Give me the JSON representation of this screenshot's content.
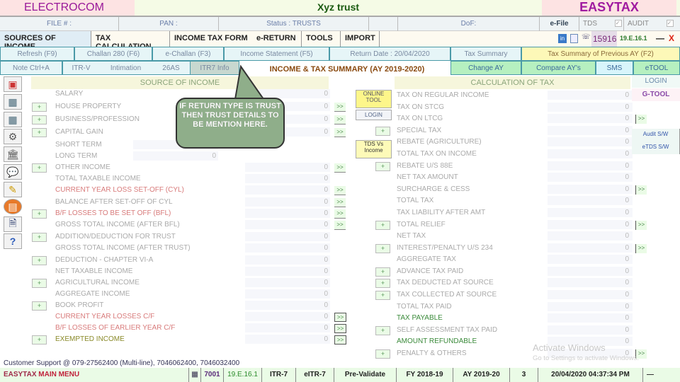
{
  "window": {
    "brand_left": "ELECTROCOM",
    "title": "Xyz trust",
    "brand_right": "EASYTAX"
  },
  "info_bar": {
    "file": "FILE # :",
    "pan": "PAN :",
    "status": "Status : TRUSTS",
    "dof": "DoF:",
    "efile": "e-File",
    "tds": "TDS",
    "audit": "AUDIT",
    "check": "✓"
  },
  "menu": {
    "items": [
      "SOURCES OF INCOME",
      "TAX CALCULATION",
      "INCOME TAX FORM",
      "e-RETURN",
      "TOOLS",
      "IMPORT"
    ],
    "counter": "15916",
    "version": "19.E.16.1",
    "minimize": "—",
    "close": "X"
  },
  "toolbar1": {
    "refresh": "Refresh (F9)",
    "challan280": "Challan 280 (F6)",
    "echallan": "e-Challan (F3)",
    "income_statement": "Income Statement (F5)",
    "return_date": "Return Date : 20/04/2020",
    "tax_summary": "Tax Summary",
    "tax_summary_prev": "Tax Summary of Previous AY (F2)"
  },
  "toolbar2": {
    "note": "Note Ctrl+A",
    "itrv": "ITR-V",
    "intimation": "Intimation",
    "26as": "26AS",
    "itr7info": "ITR7 Info",
    "summary_heading": "INCOME & TAX SUMMARY (AY 2019-2020)",
    "change_ay": "Change AY",
    "compare_ay": "Compare AY's",
    "sms": "SMS",
    "etool": "eTOOL"
  },
  "callout": "IF RETURN TYPE IS TRUST THEN TRUST DETAILS TO BE MENTION HERE.",
  "income": {
    "heading": "SOURCE OF INCOME",
    "rows": [
      {
        "label": "SALARY",
        "value": "0"
      },
      {
        "label": "HOUSE PROPERTY",
        "value": "0"
      },
      {
        "label": "BUSINESS/PROFESSION",
        "value": "0"
      },
      {
        "label": "CAPITAL GAIN",
        "value": "0"
      },
      {
        "label": "SHORT TERM",
        "value": ""
      },
      {
        "label": "LONG TERM",
        "value": "0"
      },
      {
        "label": "OTHER INCOME",
        "value": "0"
      },
      {
        "label": "TOTAL TAXABLE INCOME",
        "value": "0"
      },
      {
        "label": "CURRENT YEAR LOSS SET-OFF (CYL)",
        "value": "0"
      },
      {
        "label": "BALANCE AFTER SET-OFF OF CYL",
        "value": "0"
      },
      {
        "label": "B/F LOSSES TO BE SET OFF (BFL)",
        "value": "0"
      },
      {
        "label": "GROSS TOTAL INCOME (AFTER BFL)",
        "value": "0"
      },
      {
        "label": "ADDITION/DEDUCTION FOR TRUST",
        "value": "0"
      },
      {
        "label": "GROSS TOTAL INCOME (AFTER TRUST)",
        "value": "0"
      },
      {
        "label": "DEDUCTION - CHAPTER VI-A",
        "value": "0"
      },
      {
        "label": "NET TAXABLE INCOME",
        "value": "0"
      },
      {
        "label": "AGRICULTURAL INCOME",
        "value": "0"
      },
      {
        "label": "AGGREGATE INCOME",
        "value": "0"
      },
      {
        "label": "BOOK PROFIT",
        "value": "0"
      },
      {
        "label": "CURRENT YEAR LOSSES C/F",
        "value": "0"
      },
      {
        "label": "B/F LOSSES OF EARLIER YEAR C/F",
        "value": "0"
      },
      {
        "label": "EXEMPTED INCOME",
        "value": "0"
      }
    ],
    "plus": "+",
    "arrow": ">>"
  },
  "mid_buttons": {
    "online_tool": "ONLINE TOOL",
    "login": "LOGIN",
    "tds_vs_income": "TDS Vs Income"
  },
  "tax": {
    "heading": "CALCULATION OF TAX",
    "rows": [
      {
        "label": "TAX ON REGULAR INCOME",
        "value": "0"
      },
      {
        "label": "TAX ON STCG",
        "value": "0"
      },
      {
        "label": "TAX ON LTCG",
        "value": "0"
      },
      {
        "label": "SPECIAL TAX",
        "value": "0"
      },
      {
        "label": "REBATE (AGRICULTURE)",
        "value": "0"
      },
      {
        "label": "TOTAL TAX ON INCOME",
        "value": "0"
      },
      {
        "label": "REBATE U/S 88E",
        "value": "0"
      },
      {
        "label": "NET TAX AMOUNT",
        "value": "0"
      },
      {
        "label": "SURCHARGE & CESS",
        "value": "0"
      },
      {
        "label": "TOTAL TAX",
        "value": "0"
      },
      {
        "label": "TAX LIABILITY AFTER AMT",
        "value": "0"
      },
      {
        "label": "TOTAL RELIEF",
        "value": "0"
      },
      {
        "label": "NET TAX",
        "value": "0"
      },
      {
        "label": "INTEREST/PENALTY U/S 234",
        "value": "0"
      },
      {
        "label": "AGGREGATE TAX",
        "value": "0"
      },
      {
        "label": "ADVANCE TAX PAID",
        "value": "0"
      },
      {
        "label": "TAX DEDUCTED AT SOURCE",
        "value": "0"
      },
      {
        "label": "TAX COLLECTED AT SOURCE",
        "value": "0"
      },
      {
        "label": "TOTAL TAX PAID",
        "value": "0"
      },
      {
        "label": "TAX PAYABLE",
        "value": "0"
      },
      {
        "label": "SELF ASSESSMENT TAX PAID",
        "value": "0"
      },
      {
        "label": "AMOUNT REFUNDABLE",
        "value": "0"
      },
      {
        "label": "PENALTY & OTHERS",
        "value": "0"
      }
    ]
  },
  "right_panel": {
    "login": "LOGIN",
    "gtool": "G-TOOL",
    "audit_sw": "Audit S/W",
    "etds_sw": "eTDS S/W"
  },
  "footer": {
    "support": "Customer Support @ 079-27562400 (Multi-line), 7046062400, 7046032400",
    "main_menu_1": "EASYTAX ",
    "main_menu_2": "MAIN MENU",
    "code": "7001",
    "version": "19.E.16.1",
    "itr": "ITR-7",
    "eitr": "eITR-7",
    "prevalidate": "Pre-Validate",
    "fy": "FY 2018-19",
    "ay": "AY 2019-20",
    "count": "3",
    "datetime": "20/04/2020 04:37:34 PM",
    "dash": "—"
  },
  "watermark": {
    "line1": "Activate Windows",
    "line2": "Go to Settings to activate Windows."
  }
}
